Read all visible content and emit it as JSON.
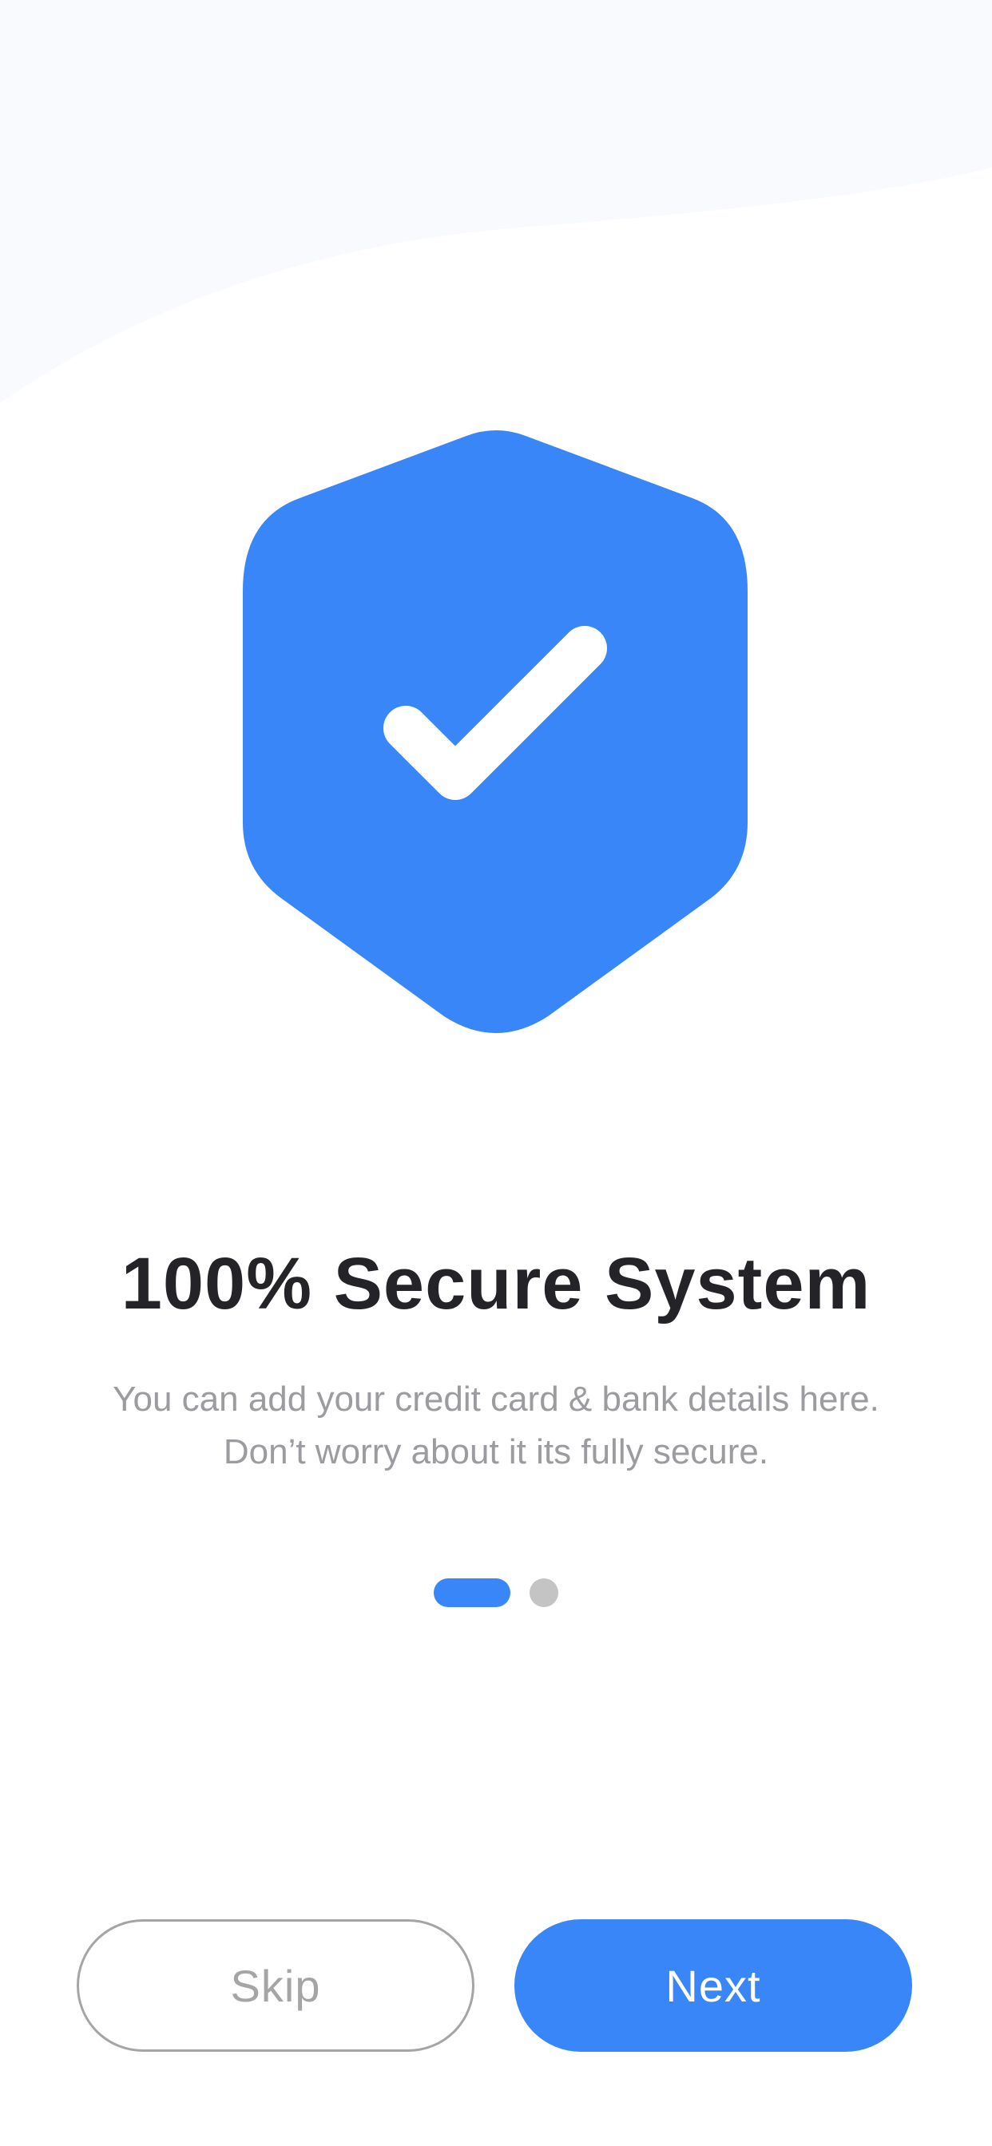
{
  "colors": {
    "accent": "#3886F8",
    "wave": "#F9FAFD",
    "title": "#242428",
    "subtitle": "#9B9BA0",
    "dot_inactive": "#C4C4C4",
    "skip_text": "#A5A5A8",
    "next_text": "#FFFFFF"
  },
  "hero": {
    "icon": "shield-check-icon"
  },
  "onboarding": {
    "title": "100% Secure System",
    "description_line1": "You can add your credit card & bank details here.",
    "description_line2": "Don’t worry about it its fully secure.",
    "page_current": 1,
    "page_total": 2
  },
  "buttons": {
    "skip_label": "Skip",
    "next_label": "Next"
  }
}
